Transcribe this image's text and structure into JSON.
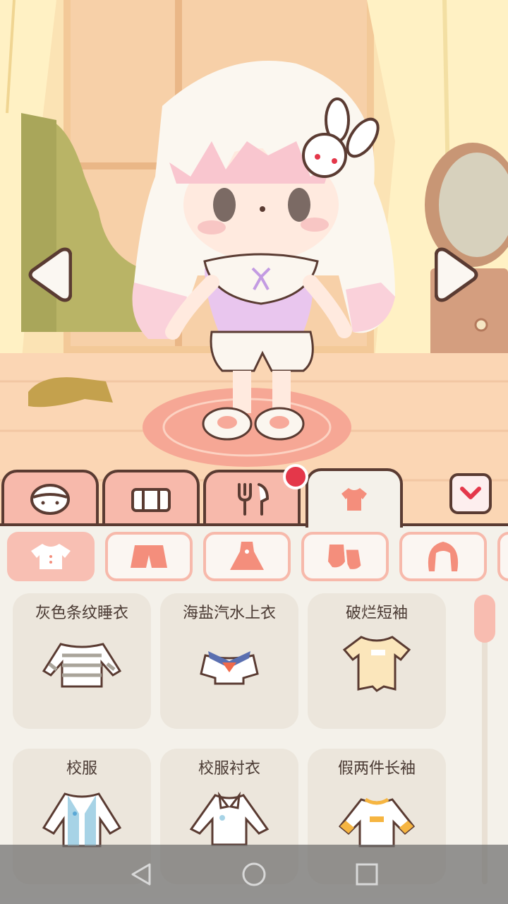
{
  "colors": {
    "tab_inactive": "#f7b9ab",
    "tab_active": "#f4f1ea",
    "outline": "#5a3b32",
    "notify_dot": "#e4374a",
    "card_bg": "#ece6dc",
    "panel_bg": "#f4f1ea",
    "subcat_border": "#f7b9ab"
  },
  "scene": {
    "left_arrow_icon": "left-arrow",
    "right_arrow_icon": "right-arrow"
  },
  "tabs": [
    {
      "icon": "face-icon",
      "active": false
    },
    {
      "icon": "furniture-icon",
      "active": false
    },
    {
      "icon": "fork-knife-icon",
      "active": false,
      "notification": true
    },
    {
      "icon": "shirt-icon",
      "active": true
    }
  ],
  "subcategories": [
    {
      "icon": "top-icon",
      "active": true
    },
    {
      "icon": "shorts-icon",
      "active": false
    },
    {
      "icon": "dress-icon",
      "active": false
    },
    {
      "icon": "socks-icon",
      "active": false
    },
    {
      "icon": "hair-icon",
      "active": false
    }
  ],
  "items": [
    {
      "label": "灰色条纹睡衣",
      "icon": "striped-sweater-icon"
    },
    {
      "label": "海盐汽水上衣",
      "icon": "sailor-top-icon"
    },
    {
      "label": "破烂短袖",
      "icon": "tattered-tshirt-icon"
    },
    {
      "label": "校服",
      "icon": "school-uniform-icon"
    },
    {
      "label": "校服衬衣",
      "icon": "uniform-shirt-icon"
    },
    {
      "label": "假两件长袖",
      "icon": "layered-longsleeve-icon"
    }
  ],
  "system_nav": [
    "back-icon",
    "home-icon",
    "recents-icon"
  ]
}
